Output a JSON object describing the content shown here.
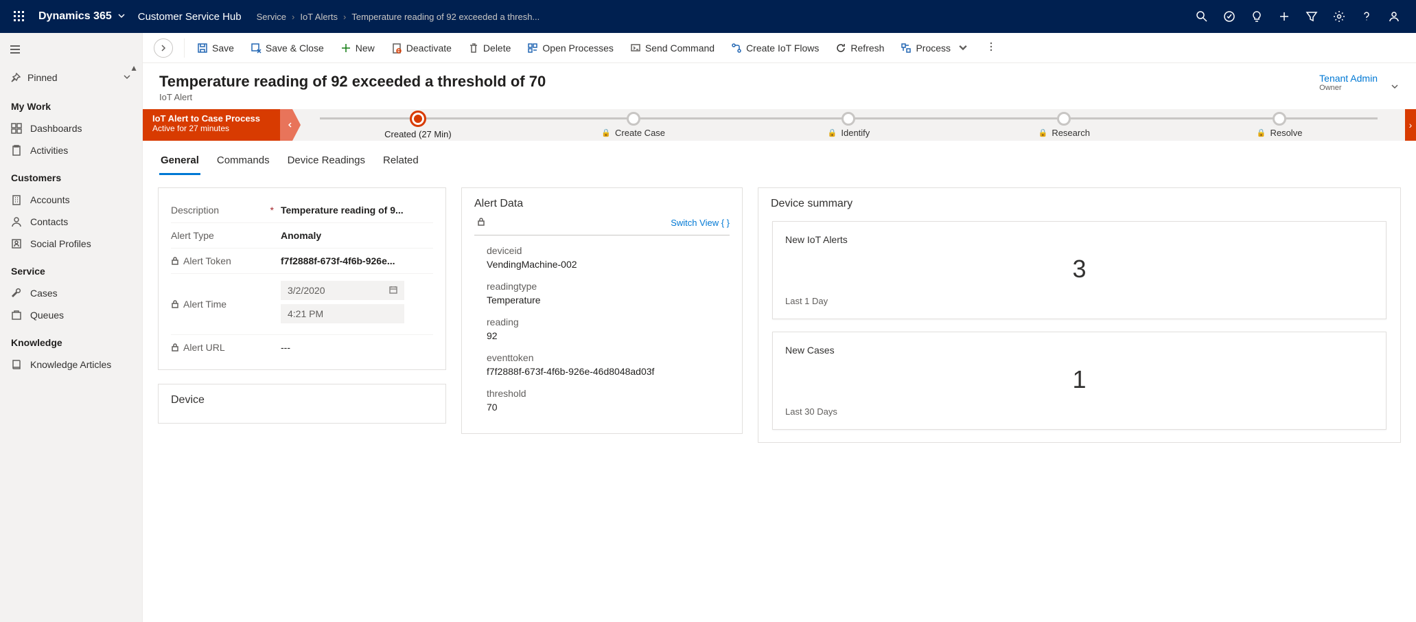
{
  "topnav": {
    "brand": "Dynamics 365",
    "appname": "Customer Service Hub",
    "breadcrumb": [
      "Service",
      "IoT Alerts",
      "Temperature reading of 92 exceeded a thresh..."
    ]
  },
  "sidebar": {
    "pinned_label": "Pinned",
    "groups": [
      {
        "title": "My Work",
        "items": [
          "Dashboards",
          "Activities"
        ]
      },
      {
        "title": "Customers",
        "items": [
          "Accounts",
          "Contacts",
          "Social Profiles"
        ]
      },
      {
        "title": "Service",
        "items": [
          "Cases",
          "Queues"
        ]
      },
      {
        "title": "Knowledge",
        "items": [
          "Knowledge Articles"
        ]
      }
    ]
  },
  "cmdbar": {
    "save": "Save",
    "save_close": "Save & Close",
    "new": "New",
    "deactivate": "Deactivate",
    "delete": "Delete",
    "open_processes": "Open Processes",
    "send_command": "Send Command",
    "create_iot_flows": "Create IoT Flows",
    "refresh": "Refresh",
    "process": "Process"
  },
  "header": {
    "title": "Temperature reading of 92 exceeded a threshold of 70",
    "subtitle": "IoT Alert",
    "owner_name": "Tenant Admin",
    "owner_label": "Owner"
  },
  "process": {
    "name": "IoT Alert to Case Process",
    "status": "Active for 27 minutes",
    "stages": [
      {
        "label": "Created  (27 Min)",
        "active": true,
        "locked": false
      },
      {
        "label": "Create Case",
        "active": false,
        "locked": true
      },
      {
        "label": "Identify",
        "active": false,
        "locked": true
      },
      {
        "label": "Research",
        "active": false,
        "locked": true
      },
      {
        "label": "Resolve",
        "active": false,
        "locked": true
      }
    ]
  },
  "tabs": [
    "General",
    "Commands",
    "Device Readings",
    "Related"
  ],
  "general": {
    "description_label": "Description",
    "description": "Temperature reading of 9...",
    "alert_type_label": "Alert Type",
    "alert_type": "Anomaly",
    "alert_token_label": "Alert Token",
    "alert_token": "f7f2888f-673f-4f6b-926e...",
    "alert_time_label": "Alert Time",
    "alert_date": "3/2/2020",
    "alert_time": "4:21 PM",
    "alert_url_label": "Alert URL",
    "alert_url": "---",
    "device_heading": "Device"
  },
  "alert_data": {
    "heading": "Alert Data",
    "switch": "Switch View  { }",
    "fields": [
      {
        "k": "deviceid",
        "v": "VendingMachine-002"
      },
      {
        "k": "readingtype",
        "v": "Temperature"
      },
      {
        "k": "reading",
        "v": "92"
      },
      {
        "k": "eventtoken",
        "v": "f7f2888f-673f-4f6b-926e-46d8048ad03f"
      },
      {
        "k": "threshold",
        "v": "70"
      }
    ]
  },
  "device_summary": {
    "heading": "Device summary",
    "cards": [
      {
        "title": "New IoT Alerts",
        "value": "3",
        "sub": "Last 1 Day"
      },
      {
        "title": "New Cases",
        "value": "1",
        "sub": "Last 30 Days"
      }
    ]
  }
}
